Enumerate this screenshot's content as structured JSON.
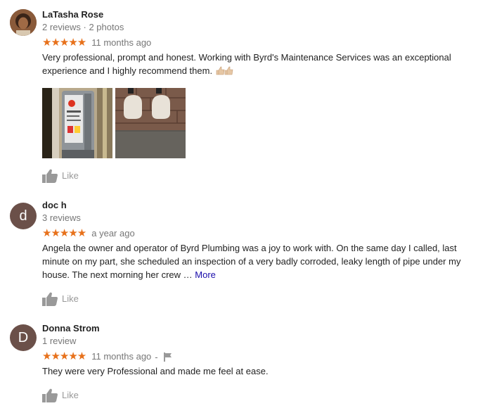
{
  "reviews": [
    {
      "name": "LaTasha Rose",
      "meta": "2 reviews · 2 photos",
      "stars": "★★★★★",
      "ago": "11 months ago",
      "text": "Very professional, prompt and honest. Working with Byrd's Maintenance Services was an exceptional experience and I highly recommend them.",
      "like_label": "Like"
    },
    {
      "name": "doc h",
      "avatar_letter": "d",
      "meta": "3 reviews",
      "stars": "★★★★★",
      "ago": "a year ago",
      "text": "Angela the owner and operator of Byrd Plumbing was a joy to work with. On the same day I called, last minute on my part, she scheduled an inspection of a very badly corroded, leaky length of pipe under my house. The next morning her crew …",
      "more": "More",
      "like_label": "Like"
    },
    {
      "name": "Donna Strom",
      "avatar_letter": "D",
      "meta": "1 review",
      "stars": "★★★★★",
      "ago": "11 months ago",
      "separator": "-",
      "text": "They were very Professional and made me feel at ease.",
      "like_label": "Like"
    }
  ],
  "colors": {
    "star": "#e7711b",
    "link": "#1a0dab",
    "muted": "#777777",
    "avatar_letter_bg": "#6b5049"
  },
  "icons": [
    "thumbs-up-icon",
    "flag-icon",
    "thumbs-up-emoji-icon"
  ]
}
